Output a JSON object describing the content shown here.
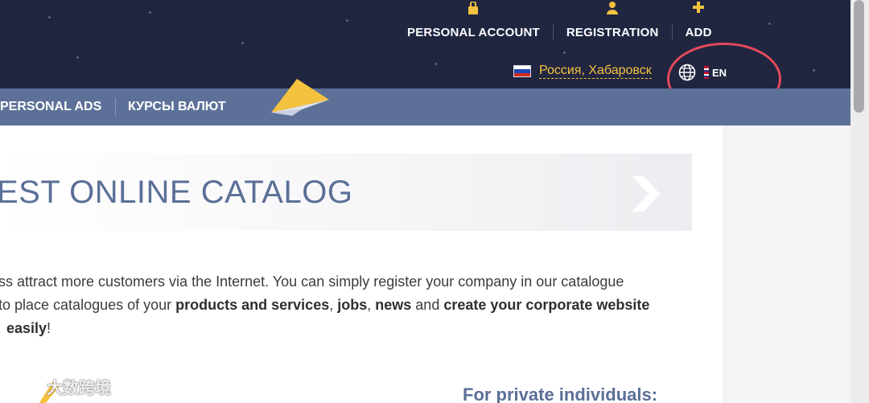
{
  "topnav": {
    "personal_account": "PERSONAL ACCOUNT",
    "registration": "REGISTRATION",
    "add": "ADD",
    "icons": [
      "lock-icon",
      "user-icon",
      "plus-icon"
    ]
  },
  "region": {
    "name": "Россия, Хабаровск",
    "flag": "russia-flag-icon"
  },
  "language": {
    "code": "EN",
    "icon": "globe-icon"
  },
  "subnav": {
    "items": [
      "PERSONAL ADS",
      "КУРСЫ ВАЛЮТ"
    ]
  },
  "banner": {
    "title": "EST ONLINE CATALOG"
  },
  "intro": {
    "line1": "ss attract more customers via the Internet. You can simply register your company in our catalogue",
    "line2_start": "to place catalogues of your ",
    "line2_b1": "products and services",
    "line2_sep1": ", ",
    "line2_b2": "jobs",
    "line2_sep2": ", ",
    "line2_b3": "news",
    "line2_mid": " and ",
    "line2_b4": "create your corporate website",
    "line3_b": "easily",
    "line3_end": "!"
  },
  "private_heading": "For private individuals:",
  "watermark": "大数跨境",
  "colors": {
    "header_bg": "#202540",
    "subnav_bg": "#5d7198",
    "accent_yellow": "#f5c23f",
    "heading_blue": "#5b6f97",
    "highlight_red": "#e44a5a"
  }
}
